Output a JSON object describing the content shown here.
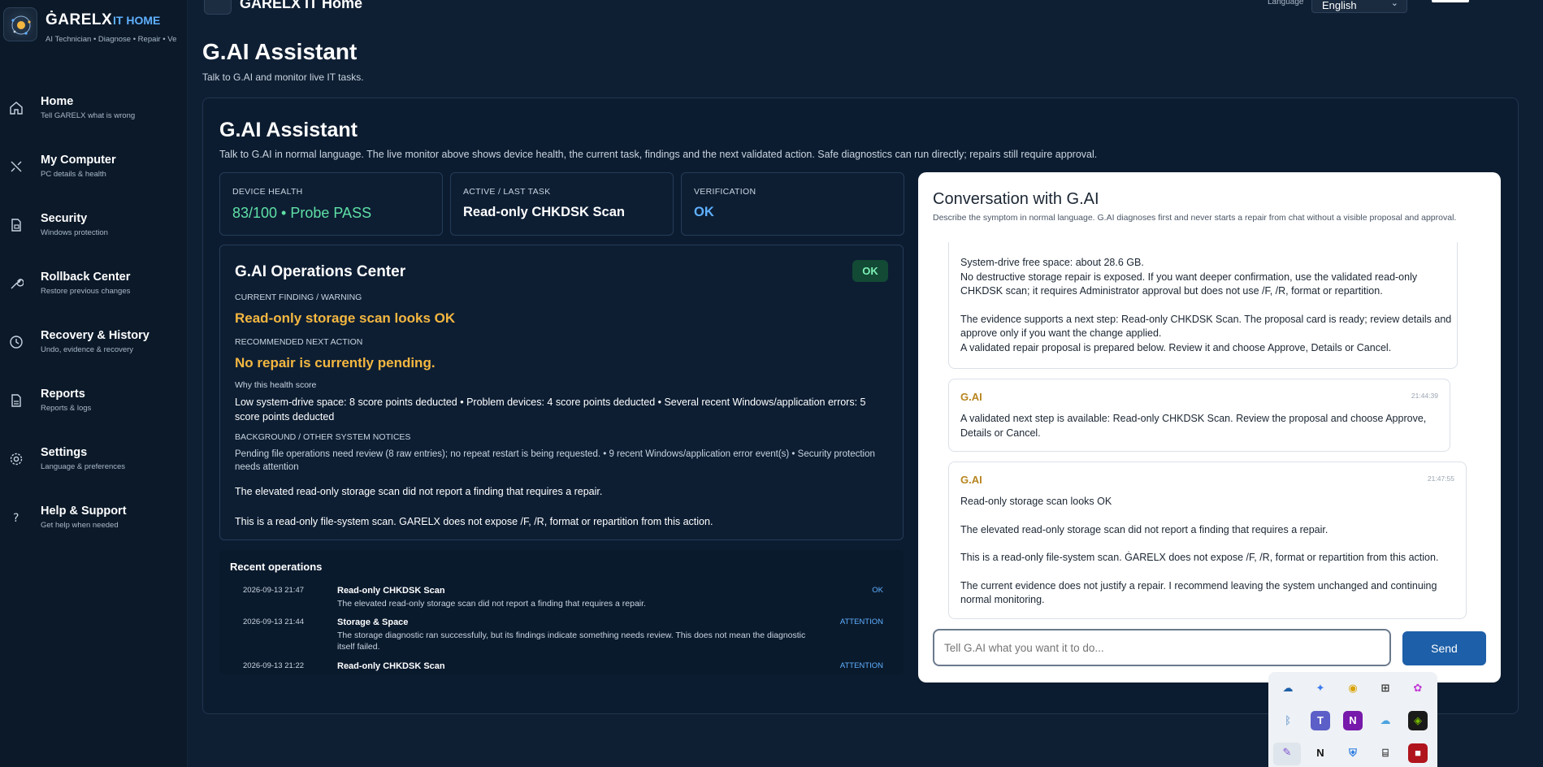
{
  "brand": {
    "name": "ĠARELX",
    "sub": "IT HOME",
    "tagline": "AI Technician • Diagnose • Repair • Veri"
  },
  "topbar": {
    "title": "ĠARELX IT Home",
    "language_label": "Language",
    "language_value": "English"
  },
  "sidebar": {
    "items": [
      {
        "title": "Home",
        "sub": "Tell GARELX what is wrong",
        "icon": "home-icon"
      },
      {
        "title": "My Computer",
        "sub": "PC details & health",
        "icon": "tools-icon"
      },
      {
        "title": "Security",
        "sub": "Windows protection",
        "icon": "security-document-icon"
      },
      {
        "title": "Rollback Center",
        "sub": "Restore previous changes",
        "icon": "wrench-icon"
      },
      {
        "title": "Recovery & History",
        "sub": "Undo, evidence & recovery",
        "icon": "clock-icon"
      },
      {
        "title": "Reports",
        "sub": "Reports & logs",
        "icon": "file-icon"
      },
      {
        "title": "Settings",
        "sub": "Language & preferences",
        "icon": "gear-icon"
      },
      {
        "title": "Help & Support",
        "sub": "Get help when needed",
        "icon": "question-icon"
      }
    ]
  },
  "page": {
    "title": "G.AI Assistant",
    "subtitle": "Talk to G.AI and monitor live IT tasks."
  },
  "panel": {
    "title": "G.AI Assistant",
    "subtitle": "Talk to G.AI in normal language. The live monitor above shows device health, the current task, findings and the next validated action. Safe diagnostics can run directly; repairs still require approval."
  },
  "stats": [
    {
      "label": "Device Health",
      "value": "83/100 • Probe PASS",
      "color": "#5fe0a6"
    },
    {
      "label": "Active / Last Task",
      "value": "Read-only CHKDSK Scan",
      "color": "#ffffff"
    },
    {
      "label": "Verification",
      "value": "OK",
      "color": "#5fb0ff"
    }
  ],
  "ops_center": {
    "title": "G.AI Operations Center",
    "badge": "OK",
    "finding_label": "Current finding / warning",
    "finding": "Read-only storage scan looks OK",
    "next_label": "Recommended next action",
    "next": "No repair is currently pending.",
    "why_label": "Why this health score",
    "why": "Low system-drive space: 8 score points deducted  •  Problem devices: 4 score points deducted  •  Several recent Windows/application errors: 5 score points deducted",
    "background_label": "Background / other system notices",
    "background": "Pending file operations need review (8 raw entries); no repeat restart is being requested.  •  9 recent Windows/application error event(s)  •  Security protection needs attention",
    "line1": "The elevated read-only storage scan did not report a finding that requires a repair.",
    "line2": "This is a read-only file-system scan. GARELX does not expose /F, /R, format or repartition from this action."
  },
  "recent": {
    "title": "Recent operations",
    "rows": [
      {
        "date": "2026-09-13 21:47",
        "title": "Read-only CHKDSK Scan",
        "desc": "The elevated read-only storage scan did not report a finding that requires a repair.",
        "status": "OK"
      },
      {
        "date": "2026-09-13 21:44",
        "title": "Storage & Space",
        "desc": "The storage diagnostic ran successfully, but its findings indicate something needs review. This does not mean the diagnostic itself failed.",
        "status": "ATTENTION"
      },
      {
        "date": "2026-09-13 21:22",
        "title": "Read-only CHKDSK Scan",
        "desc": "",
        "status": "ATTENTION"
      }
    ]
  },
  "conversation": {
    "title": "Conversation with G.AI",
    "subtitle": "Describe the symptom in normal language. G.AI diagnoses first and never starts a repair from chat without a visible proposal and approval.",
    "messages": [
      {
        "p1": "System-drive free space: about 28.6 GB.",
        "p2": "No destructive storage repair is exposed. If you want deeper confirmation, use the validated read-only CHKDSK scan; it requires Administrator approval but does not use /F, /R, format or repartition.",
        "p3": "The evidence supports a next step: Read-only CHKDSK Scan. The proposal card is ready; review details and approve only if you want the change applied.",
        "p4": "A validated repair proposal is prepared below. Review it and choose Approve, Details or Cancel."
      },
      {
        "author": "G.AI",
        "time": "21:44:39",
        "p1": "A validated next step is available: Read-only CHKDSK Scan. Review the proposal and choose Approve, Details or Cancel."
      },
      {
        "author": "G.AI",
        "time": "21:47:55",
        "p1": "Read-only storage scan looks OK",
        "p2": "The elevated read-only storage scan did not report a finding that requires a repair.",
        "p3": "This is a read-only file-system scan. ĠARELX does not expose /F, /R, format or repartition from this action.",
        "p4": "The current evidence does not justify a repair. I recommend leaving the system unchanged and continuing normal monitoring."
      }
    ],
    "input_placeholder": "Tell G.AI what you want it to do...",
    "send_label": "Send"
  },
  "tray": {
    "icons": [
      "onedrive-icon",
      "copilot-icon",
      "chrome-icon",
      "controller-icon",
      "copilot-app-icon",
      "bluetooth-icon",
      "teams-icon",
      "onenote-icon",
      "cloud-icon",
      "nvidia-icon",
      "pen-icon",
      "notion-icon",
      "defender-icon",
      "usb-icon",
      "app-icon"
    ],
    "labels": {
      "onenote": "N",
      "notion": "N"
    }
  }
}
